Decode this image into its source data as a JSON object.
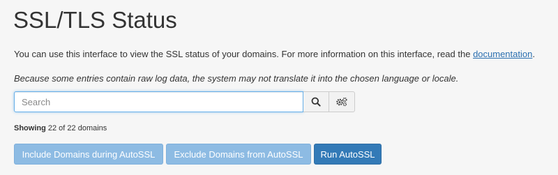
{
  "page": {
    "title": "SSL/TLS Status",
    "intro_text": "You can use this interface to view the SSL status of your domains. For more information on this interface, read the ",
    "intro_link": "documentation",
    "intro_end": ".",
    "note": "Because some entries contain raw log data, the system may not translate it into the chosen language or locale."
  },
  "search": {
    "value": "",
    "placeholder": "Search",
    "search_icon": "search-icon",
    "settings_icon": "gears-icon"
  },
  "results": {
    "showing_label": "Showing",
    "showing_count": "22 of 22 domains"
  },
  "actions": {
    "include_label": "Include Domains during AutoSSL",
    "exclude_label": "Exclude Domains from AutoSSL",
    "run_label": "Run AutoSSL"
  },
  "colors": {
    "link": "#2a6fb0",
    "primary": "#337ab7",
    "disabled_primary": "#8dbbe3"
  }
}
